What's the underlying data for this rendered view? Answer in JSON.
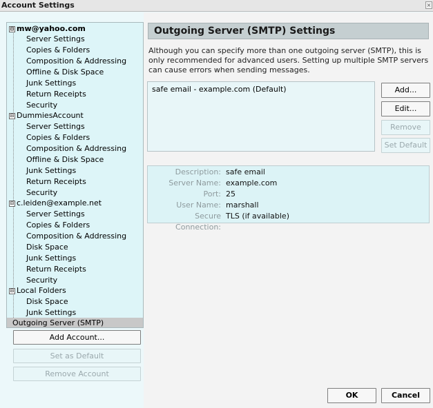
{
  "window": {
    "title": "Account Settings"
  },
  "tree": {
    "accounts": [
      {
        "name": "mw@yahoo.com",
        "bold": true,
        "items": [
          "Server Settings",
          "Copies & Folders",
          "Composition & Addressing",
          "Offline & Disk Space",
          "Junk Settings",
          "Return Receipts",
          "Security"
        ]
      },
      {
        "name": "DummiesAccount",
        "bold": false,
        "items": [
          "Server Settings",
          "Copies & Folders",
          "Composition & Addressing",
          "Offline & Disk Space",
          "Junk Settings",
          "Return Receipts",
          "Security"
        ]
      },
      {
        "name": "c.leiden@example.net",
        "bold": false,
        "items": [
          "Server Settings",
          "Copies & Folders",
          "Composition & Addressing",
          "Disk Space",
          "Junk Settings",
          "Return Receipts",
          "Security"
        ]
      },
      {
        "name": "Local Folders",
        "bold": false,
        "items": [
          "Disk Space",
          "Junk Settings"
        ]
      }
    ],
    "selected": "Outgoing Server (SMTP)",
    "toggle_symbol": "⊟"
  },
  "left_buttons": {
    "add_account": "Add Account...",
    "set_default": "Set as Default",
    "remove_account": "Remove Account"
  },
  "panel": {
    "title": "Outgoing Server (SMTP) Settings",
    "description": "Although you can specify more than one outgoing server (SMTP), this is only recommended for advanced users. Setting up multiple SMTP servers can cause errors when sending messages.",
    "servers": [
      "safe email - example.com (Default)"
    ],
    "buttons": {
      "add": "Add...",
      "edit": "Edit...",
      "remove": "Remove",
      "set_default": "Set Default"
    },
    "details": {
      "description_label": "Description:",
      "description_value": "safe email",
      "server_label": "Server Name:",
      "server_value": "example.com",
      "port_label": "Port:",
      "port_value": "25",
      "user_label": "User Name:",
      "user_value": "marshall",
      "secure_label": "Secure Connection:",
      "secure_value": "TLS (if available)"
    }
  },
  "footer": {
    "ok": "OK",
    "cancel": "Cancel"
  }
}
